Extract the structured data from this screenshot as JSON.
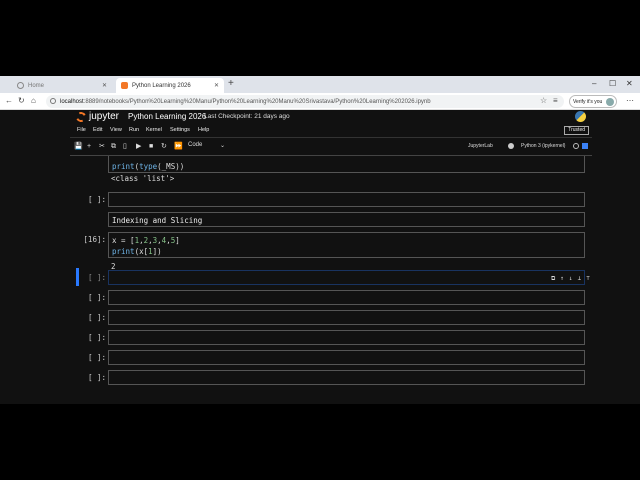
{
  "browser": {
    "tabs": [
      {
        "label": "Home"
      },
      {
        "label": "Python Learning 2026"
      }
    ],
    "url_host": "localhost",
    "url_path": ":8889/notebooks/Python%20Learning%20Manu/Python%20Learning%20Manu%20Srivastava/Python%20Learning%202026.ipynb",
    "profile_label": "Verify it's you"
  },
  "jupyter": {
    "logo_text": "jupyter",
    "notebook_title": "Python Learning 2026",
    "checkpoint": "Last Checkpoint: 21 days ago",
    "menus": [
      "File",
      "Edit",
      "View",
      "Run",
      "Kernel",
      "Settings",
      "Help"
    ],
    "trusted": "Trusted",
    "cell_type": "Code",
    "jupyterlab_link": "JupyterLab",
    "kernel_name": "Python 3 (ipykernel)"
  },
  "cells": {
    "c1": {
      "code_kw": "print",
      "code_rest1": "(",
      "code_kw2": "type",
      "code_rest2": "(_MS))",
      "output": "<class 'list'>"
    },
    "c2": {
      "prompt": "[ ]:"
    },
    "c3": {
      "markdown": "Indexing and Slicing"
    },
    "c4": {
      "prompt": "[16]:",
      "line1_a": "x = [",
      "n1": "1",
      "n2": "2",
      "n3": "3",
      "n4": "4",
      "n5": "5",
      "line2_kw": "print",
      "line2_a": "(x[",
      "line2_n": "1",
      "line2_b": "])",
      "output": "2"
    },
    "c5": {
      "prompt": "[ ]:"
    },
    "c6": {
      "prompt": "[ ]:"
    },
    "c7": {
      "prompt": "[ ]:"
    },
    "c8": {
      "prompt": "[ ]:"
    },
    "c9": {
      "prompt": "[ ]:"
    },
    "c10": {
      "prompt": "[ ]:"
    }
  }
}
